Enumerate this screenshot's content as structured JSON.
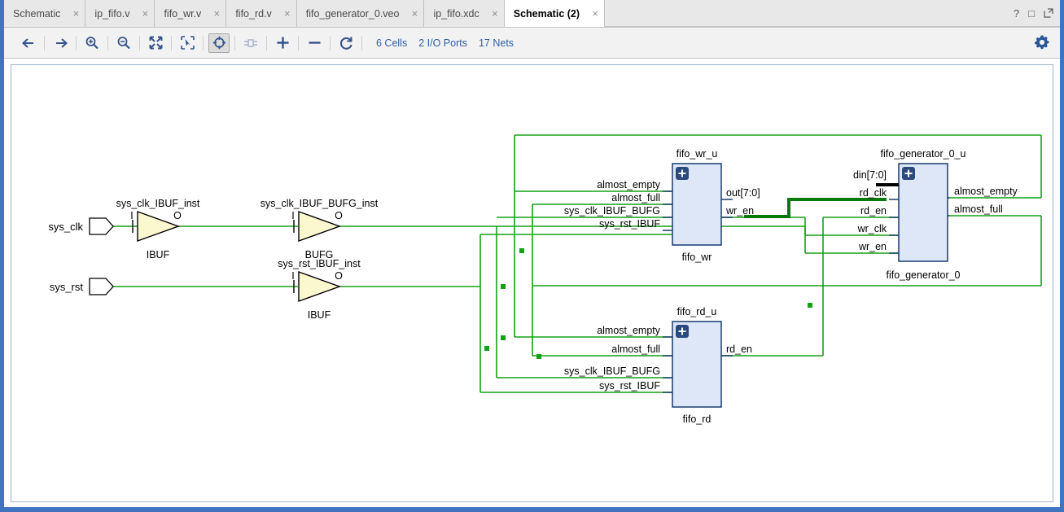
{
  "window": {
    "controls": [
      {
        "name": "help-button",
        "glyph": "?"
      },
      {
        "name": "maximize-button",
        "glyph": "□"
      },
      {
        "name": "float-button",
        "glyph": "⇱"
      }
    ]
  },
  "tabs": [
    {
      "label": "Schematic",
      "active": false,
      "close": "×"
    },
    {
      "label": "ip_fifo.v",
      "active": false,
      "close": "×"
    },
    {
      "label": "fifo_wr.v",
      "active": false,
      "close": "×"
    },
    {
      "label": "fifo_rd.v",
      "active": false,
      "close": "×"
    },
    {
      "label": "fifo_generator_0.veo",
      "active": false,
      "close": "×"
    },
    {
      "label": "ip_fifo.xdc",
      "active": false,
      "close": "×"
    },
    {
      "label": "Schematic (2)",
      "active": true,
      "close": "×"
    }
  ],
  "toolbar": {
    "buttons": [
      {
        "name": "back-button",
        "icon": "arrow-left-icon",
        "state": "normal"
      },
      {
        "name": "forward-button",
        "icon": "arrow-right-icon",
        "state": "normal"
      },
      {
        "name": "zoom-in-button",
        "icon": "zoom-in-icon",
        "state": "normal"
      },
      {
        "name": "zoom-out-button",
        "icon": "zoom-out-icon",
        "state": "normal"
      },
      {
        "name": "zoom-fit-button",
        "icon": "zoom-fit-icon",
        "state": "normal"
      },
      {
        "name": "zoom-area-button",
        "icon": "zoom-area-icon",
        "state": "normal"
      },
      {
        "name": "autofit-selection-button",
        "icon": "crosshair-icon",
        "state": "active"
      },
      {
        "name": "expand-cell-button",
        "icon": "cell-pin-icon",
        "state": "disabled"
      },
      {
        "name": "add-button",
        "icon": "plus-icon",
        "state": "normal"
      },
      {
        "name": "remove-button",
        "icon": "minus-icon",
        "state": "normal"
      },
      {
        "name": "regenerate-button",
        "icon": "refresh-icon",
        "state": "normal"
      }
    ],
    "stats": [
      {
        "name": "cells-count",
        "label": "6 Cells"
      },
      {
        "name": "io-ports-count",
        "label": "2 I/O Ports"
      },
      {
        "name": "nets-count",
        "label": "17 Nets"
      }
    ],
    "settings": {
      "name": "settings-gear",
      "icon": "gear-icon"
    }
  },
  "schematic": {
    "colors": {
      "wire": "#15a015",
      "bus": "#0a7a0a",
      "block_fill": "#dde7f7",
      "block_stroke": "#1a3a6b",
      "buffer_fill": "#fbf7cf",
      "plus_badge": "#2b4a7d"
    },
    "ports": [
      {
        "name": "sys_clk",
        "label": "sys_clk",
        "direction": "input"
      },
      {
        "name": "sys_rst",
        "label": "sys_rst",
        "direction": "input"
      }
    ],
    "buffers": [
      {
        "inst": "sys_clk_IBUF_inst",
        "type": "IBUF",
        "in_pin": "I",
        "out_pin": "O"
      },
      {
        "inst": "sys_clk_IBUF_BUFG_inst",
        "type": "BUFG",
        "in_pin": "I",
        "out_pin": "O"
      },
      {
        "inst": "sys_rst_IBUF_inst",
        "type": "IBUF",
        "in_pin": "I",
        "out_pin": "O"
      }
    ],
    "blocks": [
      {
        "inst": "fifo_wr_u",
        "type": "fifo_wr",
        "inputs": [
          "almost_empty",
          "almost_full",
          "sys_clk_IBUF_BUFG",
          "sys_rst_IBUF"
        ],
        "outputs": [
          "out[7:0]",
          "wr_en"
        ]
      },
      {
        "inst": "fifo_generator_0_u",
        "type": "fifo_generator_0",
        "inputs": [
          "din[7:0]",
          "rd_clk",
          "rd_en",
          "wr_clk",
          "wr_en"
        ],
        "outputs": [
          "almost_empty",
          "almost_full"
        ]
      },
      {
        "inst": "fifo_rd_u",
        "type": "fifo_rd",
        "inputs": [
          "almost_empty",
          "almost_full",
          "sys_clk_IBUF_BUFG",
          "sys_rst_IBUF"
        ],
        "outputs": [
          "rd_en"
        ]
      }
    ]
  }
}
